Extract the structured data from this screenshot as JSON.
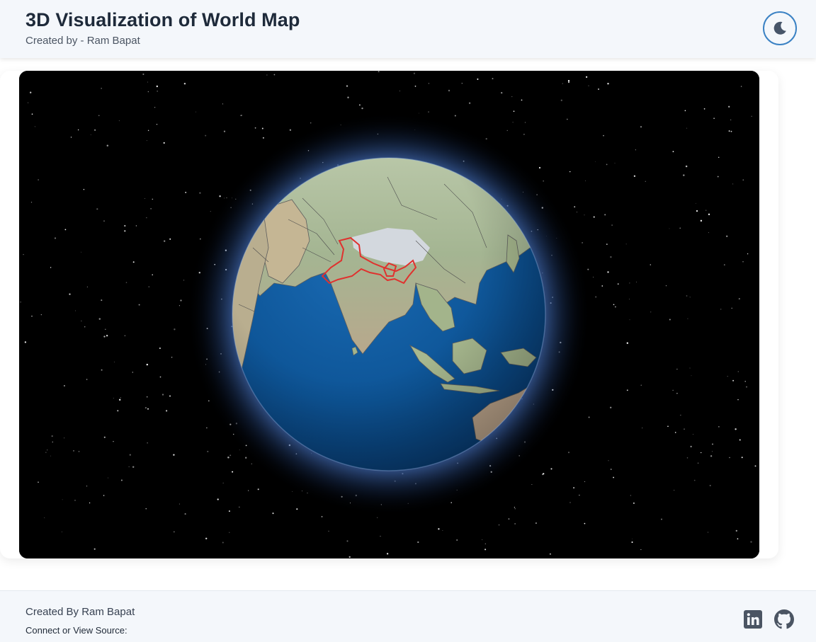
{
  "header": {
    "title": "3D Visualization of World Map",
    "subtitle": "Created by - Ram Bapat",
    "theme_toggle_icon": "moon-icon"
  },
  "globe": {
    "center_country": "India",
    "highlight_color": "#e0312e",
    "ocean_color": "#0f5aa0",
    "land_color": "#9fb79a",
    "background": "#000000"
  },
  "footer": {
    "credit": "Created By Ram Bapat",
    "connect": "Connect or View Source:",
    "links": [
      {
        "icon": "linkedin-icon"
      },
      {
        "icon": "github-icon"
      }
    ]
  }
}
